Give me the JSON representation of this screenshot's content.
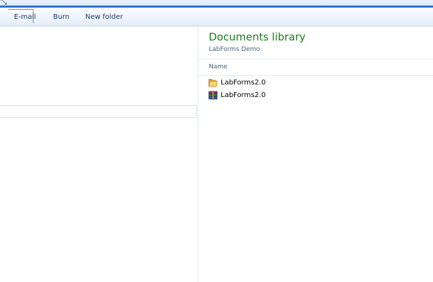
{
  "toolbar": {
    "email_label": "E-mail",
    "burn_label": "Burn",
    "new_folder_label": "New folder"
  },
  "library": {
    "title": "Documents library",
    "subtitle": "LabForms Demo",
    "column_name": "Name"
  },
  "files": [
    {
      "name": "LabForms2.0",
      "icon": "folder-icon"
    },
    {
      "name": "LabForms2.0",
      "icon": "winrar-archive-icon"
    }
  ],
  "colors": {
    "title_green": "#1e7d1e",
    "accent_blue": "#1c64c8"
  }
}
